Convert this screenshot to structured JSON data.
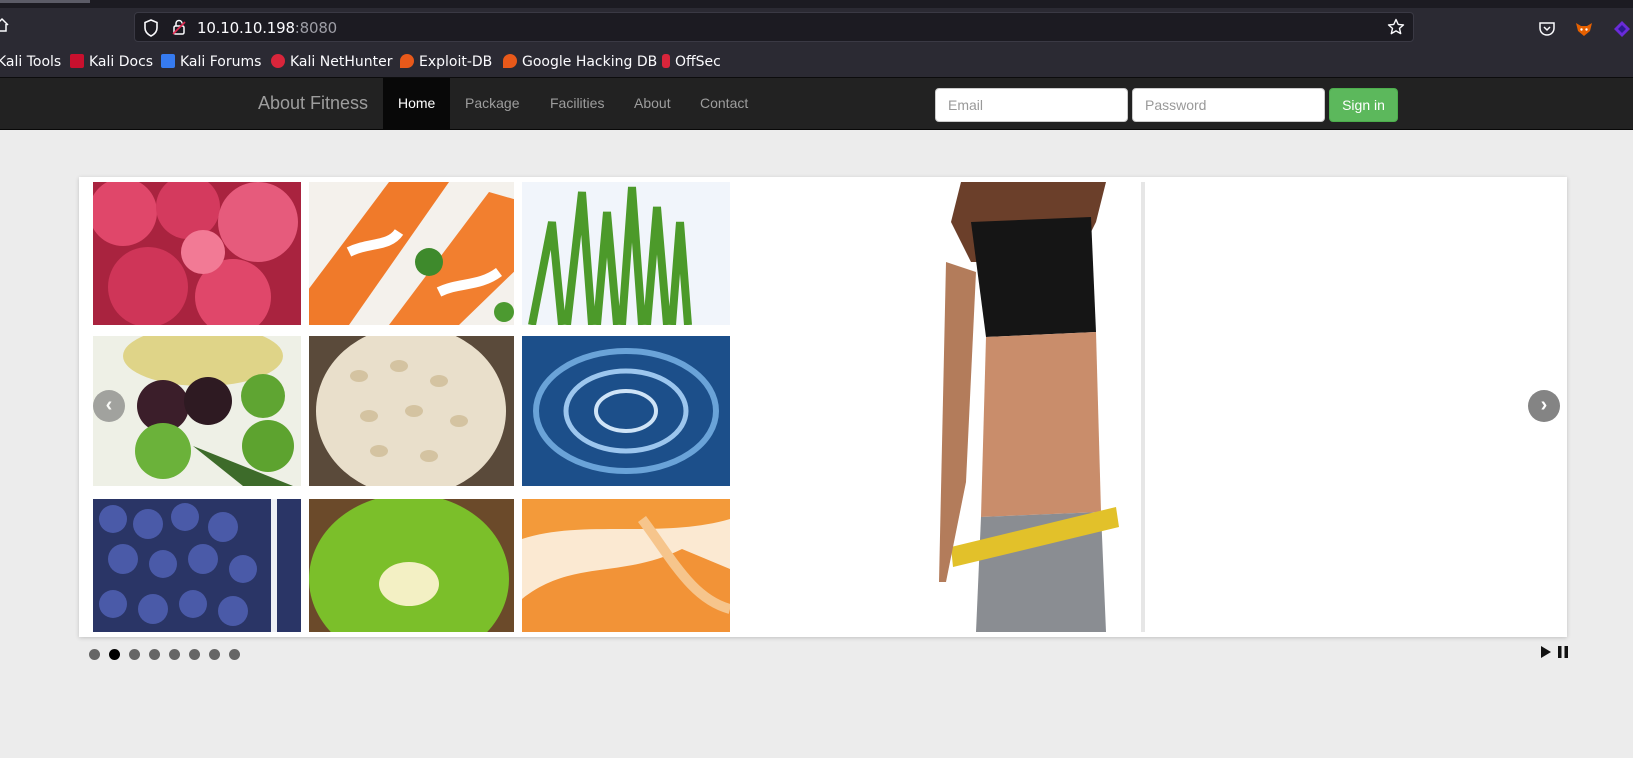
{
  "browser": {
    "url_host": "10.10.10.198",
    "url_port": ":8080",
    "bookmarks": [
      {
        "label": "Kali Tools",
        "icon": "kali-icon"
      },
      {
        "label": "Kali Docs",
        "icon": "kali-docs-icon"
      },
      {
        "label": "Kali Forums",
        "icon": "kali-forums-icon"
      },
      {
        "label": "Kali NetHunter",
        "icon": "nethunter-icon"
      },
      {
        "label": "Exploit-DB",
        "icon": "exploit-db-icon"
      },
      {
        "label": "Google Hacking DB",
        "icon": "ghdb-icon"
      },
      {
        "label": "OffSec",
        "icon": "offsec-icon"
      }
    ]
  },
  "site": {
    "brand": "About Fitness",
    "nav": [
      {
        "label": "Home",
        "active": true
      },
      {
        "label": "Package"
      },
      {
        "label": "Facilities"
      },
      {
        "label": "About"
      },
      {
        "label": "Contact"
      }
    ],
    "login": {
      "email_placeholder": "Email",
      "password_placeholder": "Password",
      "signin_label": "Sign in"
    }
  },
  "slider": {
    "tiles": [
      "raspberries",
      "salmon",
      "wheatgrass",
      "olives",
      "barley",
      "water",
      "blueberries",
      "kiwi",
      "cantaloupe"
    ],
    "dot_count": 8,
    "active_dot": 1,
    "prev_symbol": "‹",
    "next_symbol": "›"
  },
  "colors": {
    "navbar_bg": "#222222",
    "signin_green": "#5cb85c",
    "page_bg": "#ececec"
  }
}
